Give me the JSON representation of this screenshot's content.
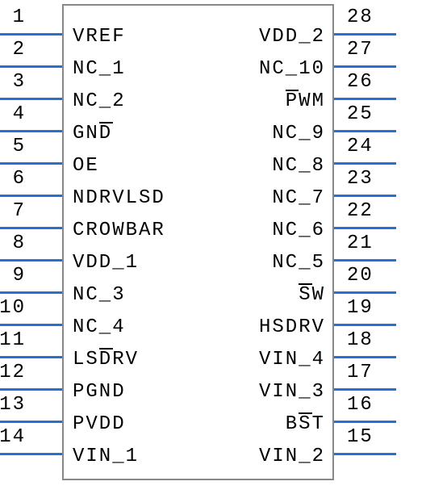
{
  "component": "IC pinout diagram",
  "left_pins": [
    {
      "num": "1",
      "label": "VREF"
    },
    {
      "num": "2",
      "label": "NC_1"
    },
    {
      "num": "3",
      "label": "NC_2"
    },
    {
      "num": "4",
      "label": "GND"
    },
    {
      "num": "5",
      "label": "OE"
    },
    {
      "num": "6",
      "label": "NDRVLSD"
    },
    {
      "num": "7",
      "label": "CROWBAR"
    },
    {
      "num": "8",
      "label": "VDD_1"
    },
    {
      "num": "9",
      "label": "NC_3"
    },
    {
      "num": "10",
      "label": "NC_4"
    },
    {
      "num": "11",
      "label": "LSDRV"
    },
    {
      "num": "12",
      "label": "PGND"
    },
    {
      "num": "13",
      "label": "PVDD"
    },
    {
      "num": "14",
      "label": "VIN_1"
    }
  ],
  "right_pins": [
    {
      "num": "28",
      "label": "VDD_2"
    },
    {
      "num": "27",
      "label": "NC_10"
    },
    {
      "num": "26",
      "label": "PWM"
    },
    {
      "num": "25",
      "label": "NC_9"
    },
    {
      "num": "24",
      "label": "NC_8"
    },
    {
      "num": "23",
      "label": "NC_7"
    },
    {
      "num": "22",
      "label": "NC_6"
    },
    {
      "num": "21",
      "label": "NC_5"
    },
    {
      "num": "20",
      "label": "SW"
    },
    {
      "num": "19",
      "label": "HSDRV"
    },
    {
      "num": "18",
      "label": "VIN_4"
    },
    {
      "num": "17",
      "label": "VIN_3"
    },
    {
      "num": "16",
      "label": "BST"
    },
    {
      "num": "15",
      "label": "VIN_2"
    }
  ],
  "overlines": {
    "left": {
      "3": {
        "text": "GND",
        "chars": [
          2
        ]
      },
      "10": {
        "text": "LSDRV",
        "chars": [
          2
        ]
      }
    },
    "right": {
      "2": {
        "text": "PWM",
        "chars": [
          0
        ]
      },
      "8": {
        "text": "SW",
        "chars": [
          0
        ]
      },
      "12": {
        "text": "BST",
        "chars": [
          1
        ]
      }
    }
  }
}
